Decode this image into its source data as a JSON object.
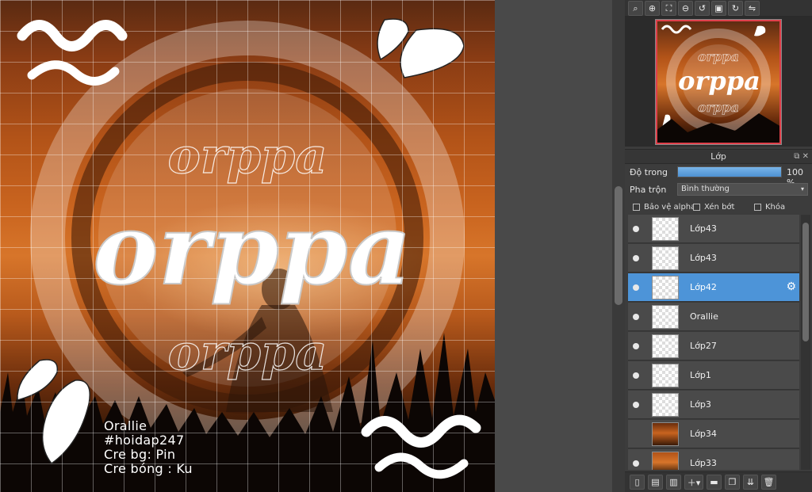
{
  "canvas": {
    "title_text": "orppa",
    "credits": [
      "Orallie",
      "#hoidap247",
      "Cre bg: Pin",
      "Cre bóng : Ku"
    ]
  },
  "navigator": {
    "toolbar": [
      "zoom-navigator-icon",
      "zoom-in-icon",
      "fit-icon",
      "zoom-out-icon",
      "rotate-left-icon",
      "reset-icon",
      "rotate-right-icon",
      "flip-icon"
    ],
    "thumb_text": "orppa"
  },
  "layers_panel": {
    "title": "Lớp",
    "opacity_label": "Độ trong",
    "opacity_value": "100 %",
    "opacity_fraction": 1.0,
    "blend_label": "Pha trộn",
    "blend_value": "Bình thường",
    "protect_alpha_label": "Bảo vệ alpha",
    "clipping_label": "Xén bớt",
    "lock_label": "Khóa",
    "layers": [
      {
        "name": "Lớp43",
        "visible": true,
        "selected": false,
        "thumb": "transparent"
      },
      {
        "name": "Lớp43",
        "visible": true,
        "selected": false,
        "thumb": "transparent"
      },
      {
        "name": "Lớp42",
        "visible": true,
        "selected": true,
        "thumb": "transparent"
      },
      {
        "name": "Orallie",
        "visible": true,
        "selected": false,
        "thumb": "transparent"
      },
      {
        "name": "Lớp27",
        "visible": true,
        "selected": false,
        "thumb": "transparent"
      },
      {
        "name": "Lớp1",
        "visible": true,
        "selected": false,
        "thumb": "transparent"
      },
      {
        "name": "Lớp3",
        "visible": true,
        "selected": false,
        "thumb": "transparent"
      },
      {
        "name": "Lớp34",
        "visible": false,
        "selected": false,
        "thumb": "photo"
      },
      {
        "name": "Lớp33",
        "visible": true,
        "selected": false,
        "thumb": "photo2"
      }
    ]
  },
  "colors": {
    "accent": "#4d94d8",
    "panel_bg": "#3c3c3c",
    "sunset": "#c9641f"
  }
}
